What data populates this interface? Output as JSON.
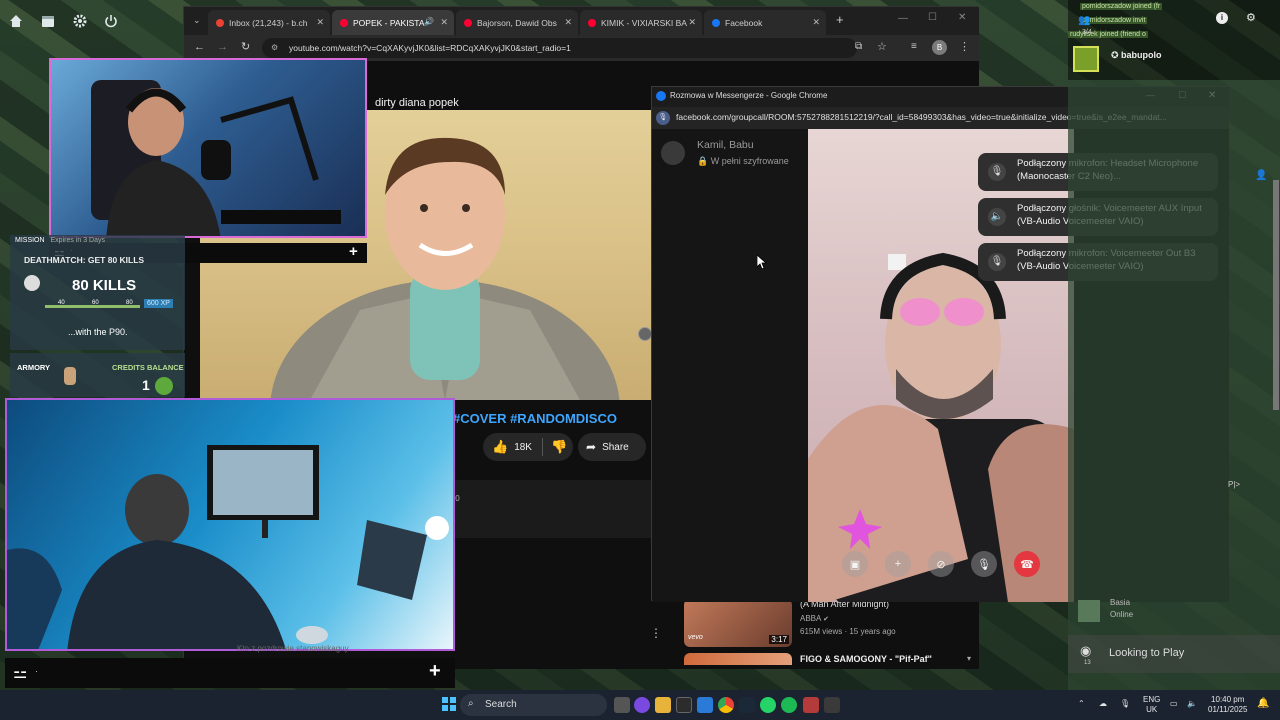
{
  "desktop": {
    "icons": [
      "home-icon",
      "calendar-icon",
      "settings-icon",
      "power-icon"
    ]
  },
  "chrome": {
    "tabs": [
      {
        "label": "Inbox (21,243) - b.ch",
        "color": "#ea4335"
      },
      {
        "label": "POPEK - PAKISTA",
        "color": "#ff0033"
      },
      {
        "label": "Bajorson, Dawid Obs",
        "color": "#ff0033"
      },
      {
        "label": "KIMIK - VIXIARSKI BA",
        "color": "#ff0033"
      },
      {
        "label": "Facebook",
        "color": "#1877f2"
      }
    ],
    "url": "youtube.com/watch?v=CqXAKyvjJK0&list=RDCqXAKyvjJK0&start_radio=1",
    "profile_initial": "B"
  },
  "youtube": {
    "playlist_title": "dirty diana popek",
    "hashtags": "#COVER #RANDOMDISCO",
    "likes": "18K",
    "share_label": "Share",
    "views_fragment": ":0",
    "recommendations": [
      {
        "title": "(A Man After Midnight)",
        "channel": "ABBA",
        "meta": "615M views · 15 years ago",
        "duration": "3:17",
        "badge": "vevo"
      },
      {
        "title": "FIGO & SAMOGONY - \"Pif-Paf\"",
        "channel": "",
        "meta": "",
        "duration": "",
        "badge": ""
      }
    ]
  },
  "messenger": {
    "window_title": "Rozmowa w Messengerze - Google Chrome",
    "url": "facebook.com/groupcall/ROOM:5752788281512219/?call_id=58499303&has_video=true&initialize_video=true&is_e2ee_mandat...",
    "participants": "Kamil, Babu",
    "encryption": "W pełni szyfrowane",
    "notifications": [
      {
        "text": "Podłączony mikrofon: Headset Microphone (Maonocaster C2 Neo)...",
        "icon": "microphone-icon"
      },
      {
        "text": "Podłączony głośnik: Voicemeeter AUX Input (VB-Audio Voicemeeter VAIO)",
        "icon": "speaker-icon"
      },
      {
        "text": "Podłączony mikrofon: Voicemeeter Out B3 (VB-Audio Voicemeeter VAIO)",
        "icon": "microphone-icon"
      }
    ]
  },
  "overlay": {
    "mission_label": "MISSION",
    "mission_expires": "Expires in 3 Days",
    "mission_title": "DEATHMATCH: GET 80 KILLS",
    "kills": "80 KILLS",
    "progress_left": "40",
    "progress_mid": "60",
    "progress_right": "80",
    "xp": "600 XP",
    "weapon_note": "...with the P90.",
    "armory": "ARMORY",
    "credits_label": "CREDITS BALANCE",
    "credits_value": "1",
    "cam_bar_text": "·",
    "bottom_ticker": "Kto z pozdrowie stanowiskaguy"
  },
  "steam": {
    "feed": [
      "pomidorszadow joined (fr",
      "pomidorszadow invit",
      "rudylisek joined (friend o"
    ],
    "party_count": "3/4",
    "username": "babupolo",
    "friend_status": "Online",
    "friend_name": "Basia",
    "looking_label": "Looking to Play",
    "looking_count": "13",
    "side_tag": "P|>"
  },
  "taskbar": {
    "search_placeholder": "Search",
    "language": "ENG\nUK",
    "lang_top": "ENG",
    "lang_bottom": "UK",
    "time": "10:40 pm",
    "date": "01/11/2025"
  }
}
